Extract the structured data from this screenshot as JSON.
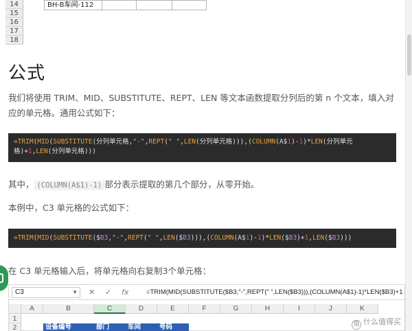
{
  "top_sheet": {
    "rows": [
      "14",
      "15",
      "16",
      "17",
      "18"
    ],
    "row14_value": "BH-B车间-112"
  },
  "section_title": "公式",
  "para1": "我们将使用 TRIM、MID、SUBSTITUTE、REPT、LEN 等文本函数提取分列后的第 n 个文本，填入对应的单元格。通用公式如下：",
  "code1": {
    "line1": [
      {
        "t": "=TRIM",
        "c": "fn"
      },
      {
        "t": "(",
        "c": "txt"
      },
      {
        "t": "MID",
        "c": "fn"
      },
      {
        "t": "(",
        "c": "txt"
      },
      {
        "t": "SUBSTITUTE",
        "c": "fn"
      },
      {
        "t": "(分列单元格,",
        "c": "txt"
      },
      {
        "t": "\"-\"",
        "c": "str"
      },
      {
        "t": ",",
        "c": "txt"
      },
      {
        "t": "REPT",
        "c": "fn"
      },
      {
        "t": "(",
        "c": "txt"
      },
      {
        "t": "\" \"",
        "c": "str"
      },
      {
        "t": ",",
        "c": "txt"
      },
      {
        "t": "LEN",
        "c": "fn"
      },
      {
        "t": "(分列单元格))),(",
        "c": "txt"
      },
      {
        "t": "COLUMN",
        "c": "fn"
      },
      {
        "t": "(A$",
        "c": "txt"
      },
      {
        "t": "1",
        "c": "num"
      },
      {
        "t": ")-",
        "c": "txt"
      },
      {
        "t": "1",
        "c": "num"
      },
      {
        "t": ")*",
        "c": "txt"
      },
      {
        "t": "LEN",
        "c": "fn"
      },
      {
        "t": "(分列单元",
        "c": "txt"
      }
    ],
    "line2": [
      {
        "t": "格)+",
        "c": "txt"
      },
      {
        "t": "1",
        "c": "num"
      },
      {
        "t": ",",
        "c": "txt"
      },
      {
        "t": "LEN",
        "c": "fn"
      },
      {
        "t": "(分列单元格)))",
        "c": "txt"
      }
    ]
  },
  "para2_prefix": "其中，",
  "para2_code": "(COLUMN(A$1)-1)",
  "para2_suffix": "部分表示提取的第几个部分，从零开始。",
  "para3": "本例中，C3 单元格的公式如下：",
  "code2": {
    "line1": [
      {
        "t": "=TRIM",
        "c": "fn"
      },
      {
        "t": "(",
        "c": "txt"
      },
      {
        "t": "MID",
        "c": "fn"
      },
      {
        "t": "(",
        "c": "txt"
      },
      {
        "t": "SUBSTITUTE",
        "c": "fn"
      },
      {
        "t": "($",
        "c": "txt"
      },
      {
        "t": "B3",
        "c": "ref"
      },
      {
        "t": ",",
        "c": "txt"
      },
      {
        "t": "\"-\"",
        "c": "str"
      },
      {
        "t": ",",
        "c": "txt"
      },
      {
        "t": "REPT",
        "c": "fn"
      },
      {
        "t": "(",
        "c": "txt"
      },
      {
        "t": "\" \"",
        "c": "str"
      },
      {
        "t": ",",
        "c": "txt"
      },
      {
        "t": "LEN",
        "c": "fn"
      },
      {
        "t": "($",
        "c": "txt"
      },
      {
        "t": "B3",
        "c": "ref"
      },
      {
        "t": "))),(",
        "c": "txt"
      },
      {
        "t": "COLUMN",
        "c": "fn"
      },
      {
        "t": "(A$",
        "c": "txt"
      },
      {
        "t": "1",
        "c": "num"
      },
      {
        "t": ")-",
        "c": "txt"
      },
      {
        "t": "1",
        "c": "num"
      },
      {
        "t": ")*",
        "c": "txt"
      },
      {
        "t": "LEN",
        "c": "fn"
      },
      {
        "t": "($",
        "c": "txt"
      },
      {
        "t": "B3",
        "c": "ref"
      },
      {
        "t": ")+",
        "c": "txt"
      },
      {
        "t": "1",
        "c": "num"
      },
      {
        "t": ",",
        "c": "txt"
      },
      {
        "t": "LEN",
        "c": "fn"
      },
      {
        "t": "($",
        "c": "txt"
      },
      {
        "t": "B3",
        "c": "ref"
      },
      {
        "t": ")))",
        "c": "txt"
      }
    ]
  },
  "para4": "在 C3 单元格输入后，将单元格向右复制3个单元格：",
  "bottom_sheet": {
    "name_box": "C3",
    "name_box_dropdown": "▼",
    "btn_cancel": "✕",
    "btn_confirm": "✓",
    "btn_fx": "fx",
    "formula": "=TRIM(MID(SUBSTITUTE($B3,\"-\",REPT(\" \",LEN($B3))),(COLUMN(A$1)-1)*LEN($B3)+1,LEN($B3)))",
    "columns": [
      "A",
      "B",
      "C",
      "D",
      "E",
      "F",
      "G",
      "H",
      "I",
      "J",
      "K"
    ],
    "rows": [
      "1",
      "2"
    ],
    "headers": [
      "设备编号",
      "部门",
      "车间",
      "号码"
    ]
  },
  "watermark": "什么值得买",
  "watermark_icon": "值",
  "colors": {
    "code_bg": "#2b2b2b",
    "fn": "#e9a23b",
    "string": "#a5c261",
    "number": "#e15757",
    "ref": "#c082e0",
    "header_fill": "#2e5fb4",
    "excel_green": "#217346"
  }
}
